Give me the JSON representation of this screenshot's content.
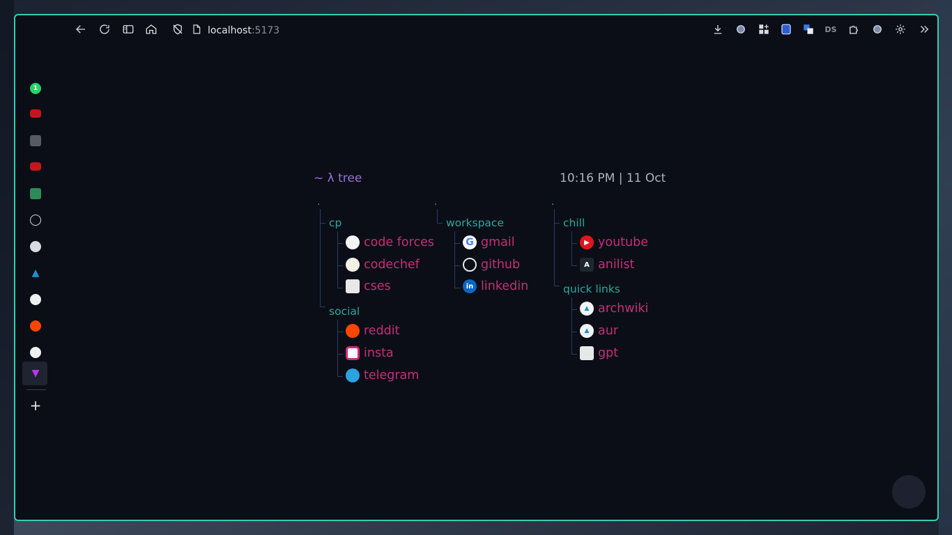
{
  "toolbar": {
    "url_host": "localhost",
    "url_port": ":5173",
    "icons": [
      "back-arrow-icon",
      "reload-icon",
      "sidebar-toggle-icon",
      "home-icon",
      "shield-off-icon",
      "page-icon",
      "download-icon",
      "extension-icon",
      "grid-icon",
      "bitwarden-icon",
      "translate-icon",
      "ds-icon",
      "puzzle-icon",
      "profile-icon",
      "gear-icon",
      "chevron-right-double-icon"
    ]
  },
  "sidebar": {
    "badge_count": "1",
    "add_label": "+"
  },
  "page": {
    "prompt_tilde": "~",
    "prompt_lambda": "λ",
    "prompt_cmd": "tree",
    "clock": "10:16 PM | 11 Oct",
    "columns": [
      {
        "root": ".",
        "groups": [
          {
            "name": "cp",
            "links": [
              "code forces",
              "codechef",
              "cses"
            ]
          },
          {
            "name": "social",
            "links": [
              "reddit",
              "insta",
              "telegram"
            ]
          }
        ]
      },
      {
        "root": ".",
        "groups": [
          {
            "name": "workspace",
            "links": [
              "gmail",
              "github",
              "linkedin"
            ]
          }
        ]
      },
      {
        "root": ".",
        "groups": [
          {
            "name": "chill",
            "links": [
              "youtube",
              "anilist"
            ]
          },
          {
            "name": "quick links",
            "links": [
              "archwiki",
              "aur",
              "gpt"
            ]
          }
        ]
      }
    ]
  },
  "colors": {
    "accent_border": "#2fd1b3",
    "link": "#c2307a",
    "folder": "#2aa7a0",
    "prompt": "#9b6fd6",
    "background": "#0b0e16"
  }
}
